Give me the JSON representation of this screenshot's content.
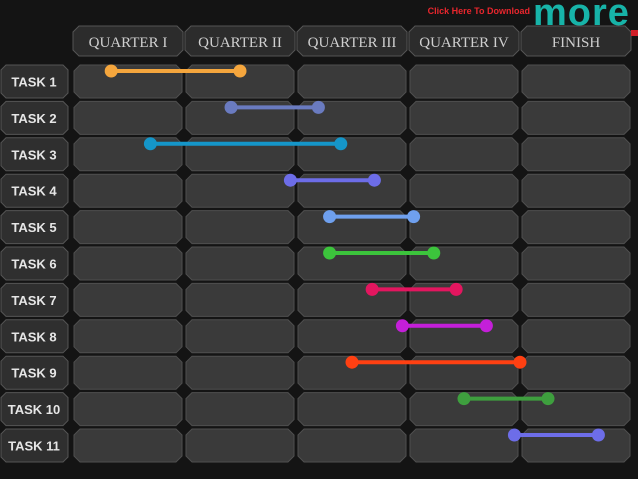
{
  "header": {
    "download_link": "Click Here To Download",
    "brand": "more"
  },
  "colors": {
    "background": "#141414",
    "cell_fill": "#3a3a3a",
    "cell_stroke": "#4f4f4f",
    "label_fill": "#2f2f2f",
    "label_text": "#e6e6e6",
    "header_text": "#cfcfcf",
    "link_red": "#e8262d",
    "brand_teal": "#17b3a8"
  },
  "chart_data": {
    "type": "gantt",
    "columns": [
      "QUARTER I",
      "QUARTER II",
      "QUARTER III",
      "QUARTER IV",
      "FINISH"
    ],
    "x_domain": [
      0,
      5
    ],
    "tasks": [
      {
        "label": "TASK 1",
        "start": 0.35,
        "end": 1.5,
        "color": "#f5a63d"
      },
      {
        "label": "TASK 2",
        "start": 1.42,
        "end": 2.2,
        "color": "#6a7bc0"
      },
      {
        "label": "TASK 3",
        "start": 0.7,
        "end": 2.4,
        "color": "#1596c9"
      },
      {
        "label": "TASK 4",
        "start": 1.95,
        "end": 2.7,
        "color": "#6d6de8"
      },
      {
        "label": "TASK 5",
        "start": 2.3,
        "end": 3.05,
        "color": "#6fa0ee"
      },
      {
        "label": "TASK 6",
        "start": 2.3,
        "end": 3.23,
        "color": "#3cc43c"
      },
      {
        "label": "TASK 7",
        "start": 2.68,
        "end": 3.43,
        "color": "#e3165f"
      },
      {
        "label": "TASK 8",
        "start": 2.95,
        "end": 3.7,
        "color": "#c41fd9"
      },
      {
        "label": "TASK 9",
        "start": 2.5,
        "end": 4.0,
        "color": "#ff4012"
      },
      {
        "label": "TASK 10",
        "start": 3.5,
        "end": 4.25,
        "color": "#3e9f3e"
      },
      {
        "label": "TASK 11",
        "start": 3.95,
        "end": 4.7,
        "color": "#6d6de8"
      }
    ]
  }
}
